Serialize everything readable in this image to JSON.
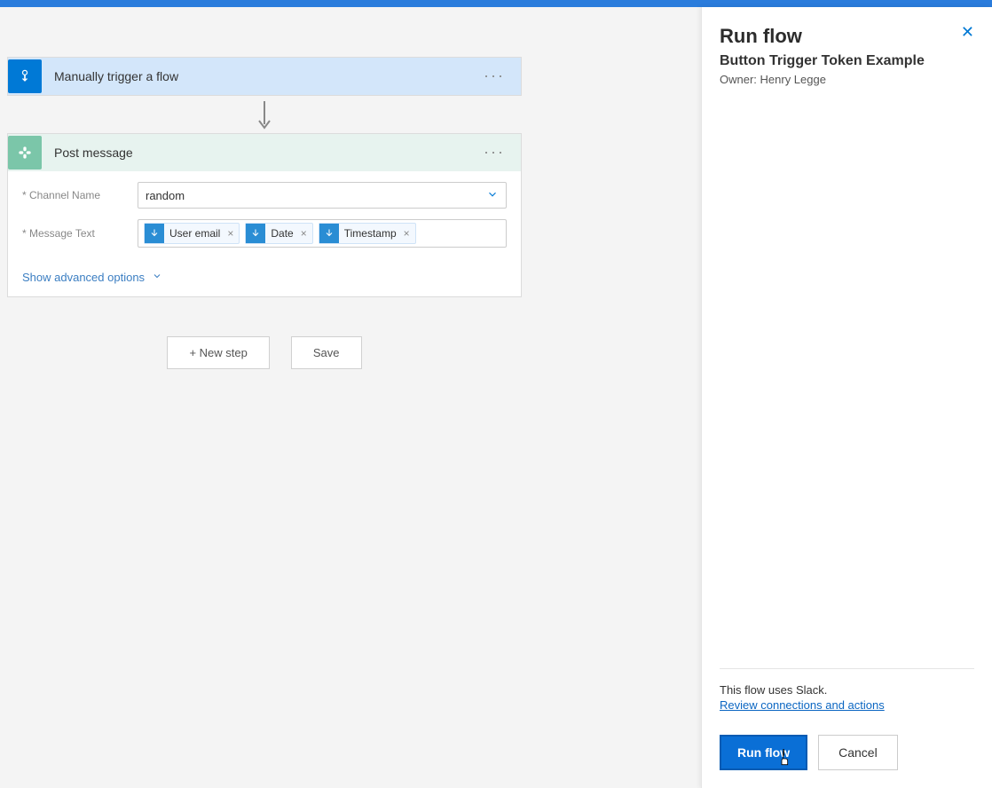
{
  "trigger": {
    "title": "Manually trigger a flow"
  },
  "action": {
    "title": "Post message",
    "fields": {
      "channel_label": "* Channel Name",
      "channel_value": "random",
      "message_label": "* Message Text",
      "tokens": [
        {
          "label": "User email"
        },
        {
          "label": "Date"
        },
        {
          "label": "Timestamp"
        }
      ]
    },
    "show_advanced": "Show advanced options"
  },
  "step_buttons": {
    "new_step": "+ New step",
    "save": "Save"
  },
  "panel": {
    "title": "Run flow",
    "subtitle": "Button Trigger Token Example",
    "owner": "Owner: Henry Legge",
    "uses_text": "This flow uses Slack.",
    "review_link": "Review connections and actions",
    "run_button": "Run flow",
    "cancel_button": "Cancel"
  }
}
